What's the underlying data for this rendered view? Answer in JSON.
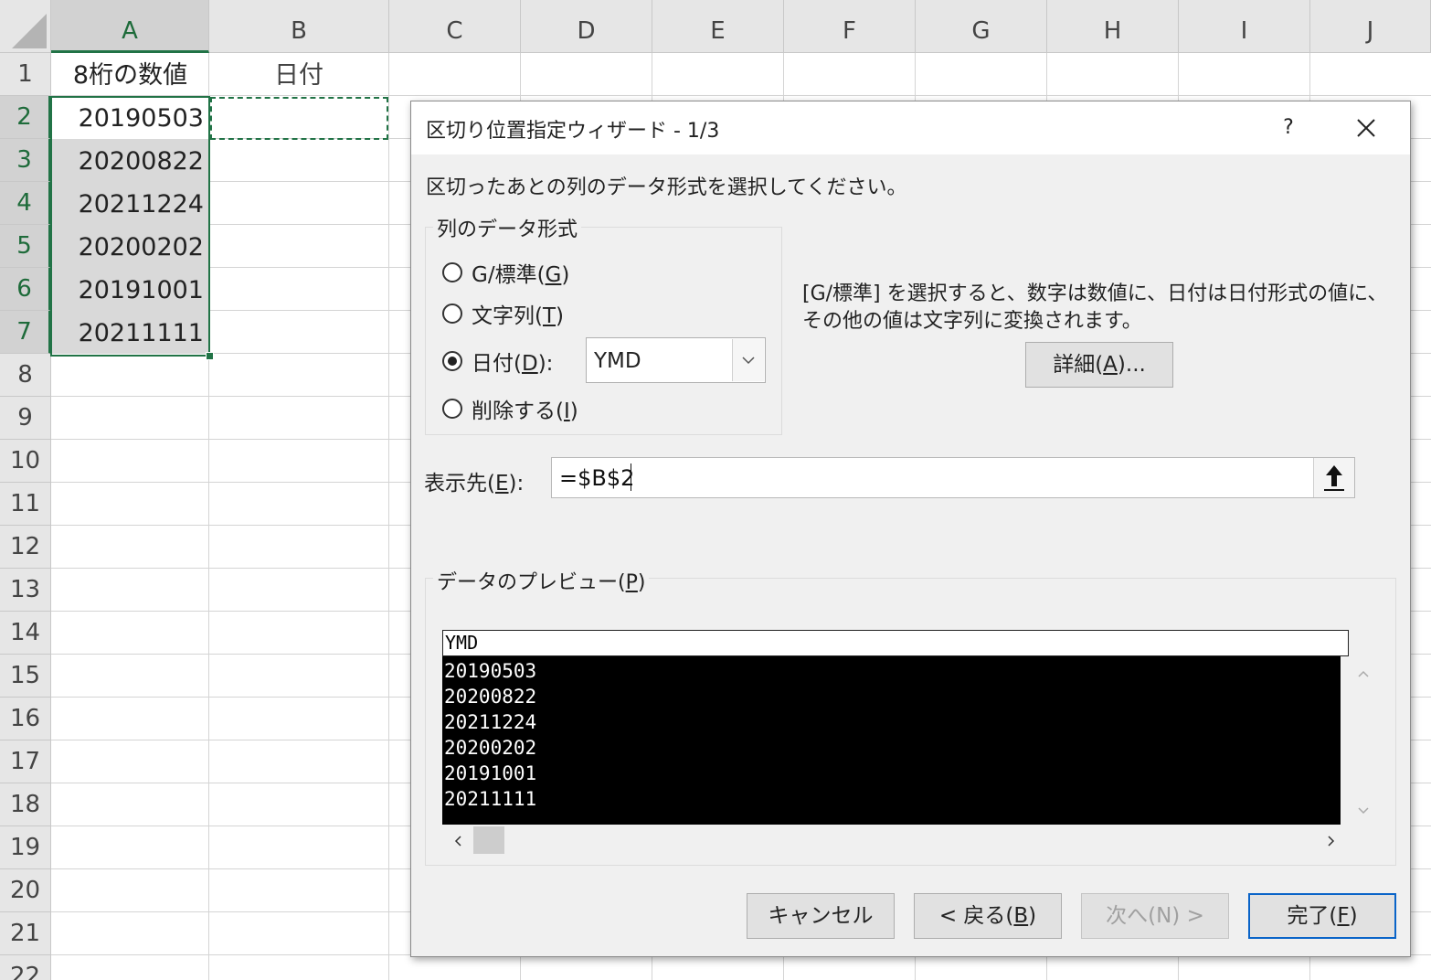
{
  "sheet": {
    "columns": [
      "A",
      "B",
      "C",
      "D",
      "E",
      "F",
      "G",
      "H",
      "I",
      "J"
    ],
    "rows": [
      "1",
      "2",
      "3",
      "4",
      "5",
      "6",
      "7",
      "8",
      "9",
      "10",
      "11",
      "12",
      "13",
      "14",
      "15",
      "16",
      "17",
      "18",
      "19",
      "20",
      "21",
      "22"
    ],
    "header_a1": "8桁の数値",
    "header_b1": "日付",
    "values": [
      "20190503",
      "20200822",
      "20211224",
      "20200202",
      "20191001",
      "20211111"
    ]
  },
  "dialog": {
    "title": "区切り位置指定ウィザード - 1/3",
    "help_label": "?",
    "instruction": "区切ったあとの列のデータ形式を選択してください。",
    "format_group_label": "列のデータ形式",
    "options": [
      {
        "label": "G/標準(",
        "accel": "G",
        "suffix": ")",
        "selected": false
      },
      {
        "label": "文字列(",
        "accel": "T",
        "suffix": ")",
        "selected": false
      },
      {
        "label": "日付(",
        "accel": "D",
        "suffix": "):",
        "selected": true
      },
      {
        "label": "削除する(",
        "accel": "I",
        "suffix": ")",
        "selected": false
      }
    ],
    "date_format": "YMD",
    "description_line1": "[G/標準] を選択すると、数字は数値に、日付は日付形式の値に、",
    "description_line2": "その他の値は文字列に変換されます。",
    "advanced_button": {
      "label": "詳細(",
      "accel": "A",
      "suffix": ")..."
    },
    "destination_label": {
      "label": "表示先(",
      "accel": "E",
      "suffix": "):"
    },
    "destination_value": "=$B$2",
    "preview_label": {
      "label": "データのプレビュー(",
      "accel": "P",
      "suffix": ")"
    },
    "preview_header": "YMD",
    "preview_rows": [
      "20190503",
      "20200822",
      "20211224",
      "20200202",
      "20191001",
      "20211111"
    ],
    "buttons": {
      "cancel": "キャンセル",
      "back": {
        "label": "< 戻る(",
        "accel": "B",
        "suffix": ")"
      },
      "next": "次へ(N) >",
      "finish": {
        "label": "完了(",
        "accel": "F",
        "suffix": ")"
      }
    }
  },
  "colors": {
    "excel_green": "#217346",
    "selected_fill": "#d9d9d9",
    "dialog_bg": "#f0f0f0"
  }
}
